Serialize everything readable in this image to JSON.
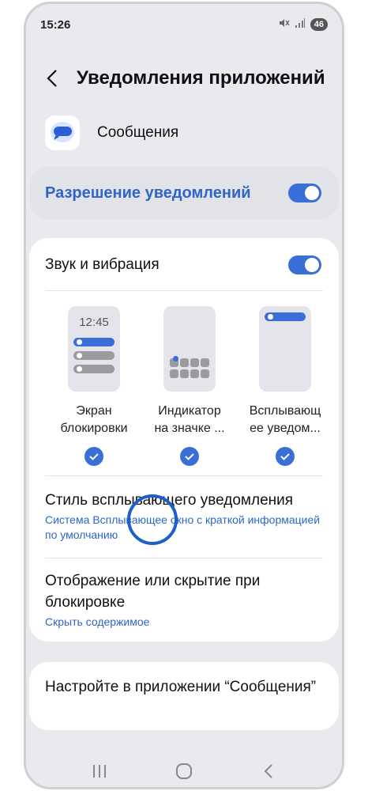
{
  "status": {
    "time": "15:26",
    "battery": "46"
  },
  "header": {
    "title": "Уведомления приложений"
  },
  "app": {
    "name": "Сообщения"
  },
  "permission": {
    "label": "Разрешение уведомлений",
    "enabled": true
  },
  "sound": {
    "label": "Звук и вибрация",
    "enabled": true
  },
  "previews": [
    {
      "line1": "Экран",
      "line2": "блокировки",
      "clock": "12:45",
      "checked": true
    },
    {
      "line1": "Индикатор",
      "line2": "на значке ...",
      "checked": true
    },
    {
      "line1": "Всплывающ",
      "line2": "ее уведом...",
      "checked": true
    }
  ],
  "popup_style": {
    "title": "Стиль всплывающего уведомления",
    "subtitle": "Система Всплывающее окно с краткой информацией по умолчанию"
  },
  "lock_display": {
    "title": "Отображение или скрытие при блокировке",
    "subtitle": "Скрыть содержимое"
  },
  "in_app": {
    "text": "Настройте в приложении “Сообщения”"
  },
  "colors": {
    "accent": "#3a6fd8",
    "link": "#2f65c6",
    "background": "#e9eaee"
  }
}
